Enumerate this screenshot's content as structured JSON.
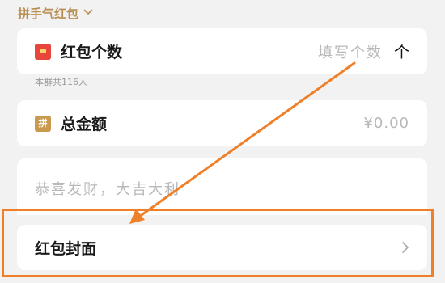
{
  "header": {
    "mode_label": "拼手气红包"
  },
  "count_row": {
    "label": "红包个数",
    "placeholder": "填写个数",
    "unit": "个",
    "icon": "red-packet-icon"
  },
  "member_hint": "本群共116人",
  "amount_row": {
    "label": "总金额",
    "value": "¥0.00",
    "icon": "pin-icon",
    "icon_text": "拼"
  },
  "message": {
    "placeholder": "恭喜发财，大吉大利"
  },
  "cover_row": {
    "label": "红包封面",
    "icon": "chevron-right-icon"
  },
  "annotation": {
    "color": "#f07f2a"
  },
  "colors": {
    "accent_gold": "#b98e52",
    "red_packet": "#e8453c",
    "background": "#f2f2f2"
  }
}
